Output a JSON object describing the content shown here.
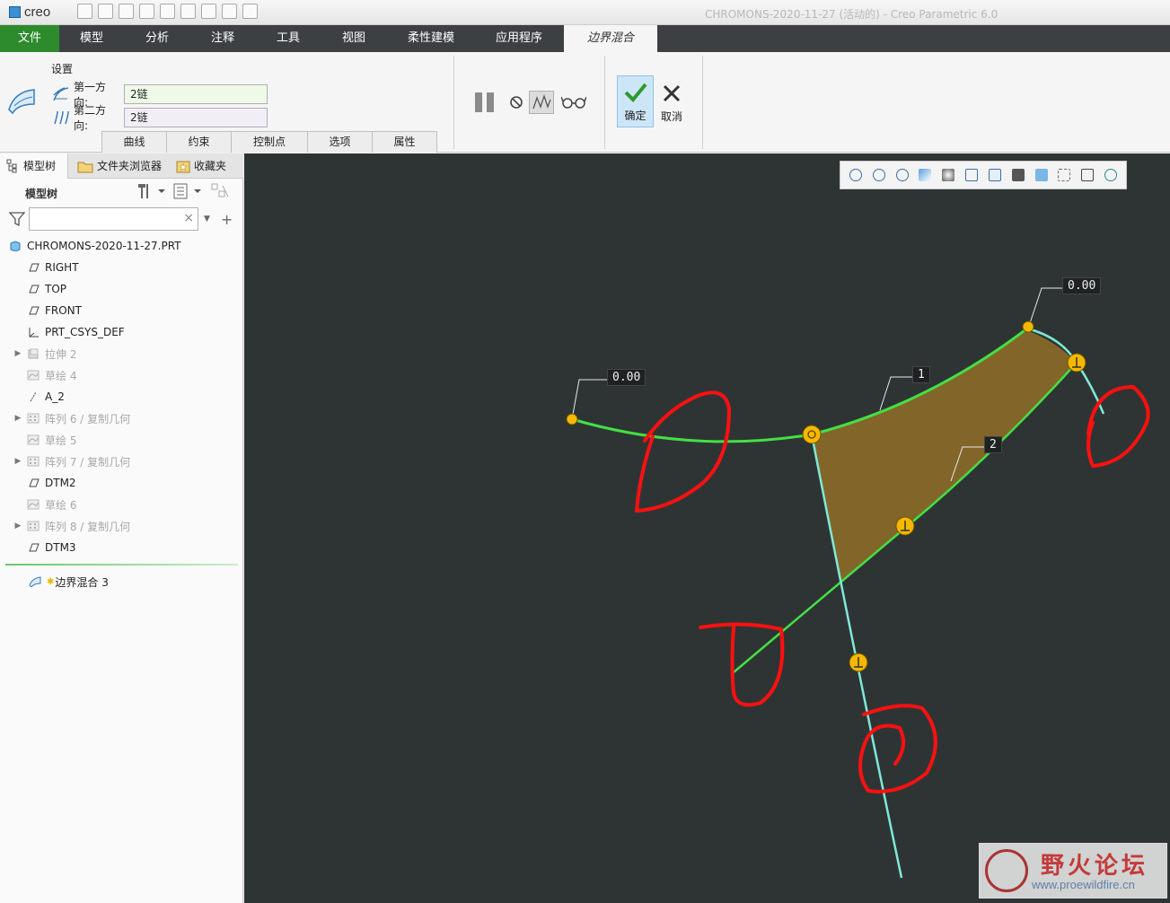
{
  "app": {
    "logo": "creo",
    "window_title": "CHROMONS-2020-11-27 (活动的) - Creo Parametric 6.0"
  },
  "ribbon_tabs": [
    {
      "label": "文件"
    },
    {
      "label": "模型"
    },
    {
      "label": "分析"
    },
    {
      "label": "注释"
    },
    {
      "label": "工具"
    },
    {
      "label": "视图"
    },
    {
      "label": "柔性建模"
    },
    {
      "label": "应用程序"
    },
    {
      "label": "边界混合"
    }
  ],
  "ribbon": {
    "group_title": "设置",
    "first_direction_label": "第一方向:",
    "first_direction_value": "2链",
    "second_direction_label": "第二方向:",
    "second_direction_value": "2链",
    "subtabs": [
      {
        "label": "曲线"
      },
      {
        "label": "约束"
      },
      {
        "label": "控制点"
      },
      {
        "label": "选项"
      },
      {
        "label": "属性"
      }
    ],
    "ok_label": "确定",
    "cancel_label": "取消"
  },
  "left_panel": {
    "tabs": [
      {
        "label": "模型树"
      },
      {
        "label": "文件夹浏览器"
      },
      {
        "label": "收藏夹"
      }
    ],
    "tree_header": "模型树",
    "search_placeholder": "",
    "tree_root": "CHROMONS-2020-11-27.PRT",
    "tree_items": [
      {
        "label": "RIGHT",
        "icon": "datum-plane-icon",
        "expandable": false,
        "dim": false
      },
      {
        "label": "TOP",
        "icon": "datum-plane-icon",
        "expandable": false,
        "dim": false
      },
      {
        "label": "FRONT",
        "icon": "datum-plane-icon",
        "expandable": false,
        "dim": false
      },
      {
        "label": "PRT_CSYS_DEF",
        "icon": "csys-icon",
        "expandable": false,
        "dim": false
      },
      {
        "label": "拉伸 2",
        "icon": "extrude-icon",
        "expandable": true,
        "dim": true
      },
      {
        "label": "草绘 4",
        "icon": "sketch-icon",
        "expandable": false,
        "dim": true
      },
      {
        "label": "A_2",
        "icon": "axis-icon",
        "expandable": false,
        "dim": false
      },
      {
        "label": "阵列 6 / 复制几何",
        "icon": "pattern-icon",
        "expandable": true,
        "dim": true
      },
      {
        "label": "草绘 5",
        "icon": "sketch-icon",
        "expandable": false,
        "dim": true
      },
      {
        "label": "阵列 7 / 复制几何",
        "icon": "pattern-icon",
        "expandable": true,
        "dim": true
      },
      {
        "label": "DTM2",
        "icon": "datum-plane-icon",
        "expandable": false,
        "dim": false
      },
      {
        "label": "草绘 6",
        "icon": "sketch-icon",
        "expandable": false,
        "dim": true
      },
      {
        "label": "阵列 8 / 复制几何",
        "icon": "pattern-icon",
        "expandable": true,
        "dim": true
      },
      {
        "label": "DTM3",
        "icon": "datum-plane-icon",
        "expandable": false,
        "dim": false
      }
    ],
    "active_feature": "边界混合 3"
  },
  "graphics": {
    "dim_labels": [
      {
        "text": "0.00"
      },
      {
        "text": "0.00"
      },
      {
        "text": "1"
      },
      {
        "text": "2"
      }
    ],
    "colors": {
      "background": "#2e3434",
      "curve_green": "#44e044",
      "curve_cyan": "#7fe8d8",
      "surface": "#8a6a28",
      "handle": "#f5b800",
      "annotation_red": "#ff1010"
    }
  },
  "watermark": {
    "text": "野火论坛",
    "url": "www.proewildfire.cn"
  }
}
